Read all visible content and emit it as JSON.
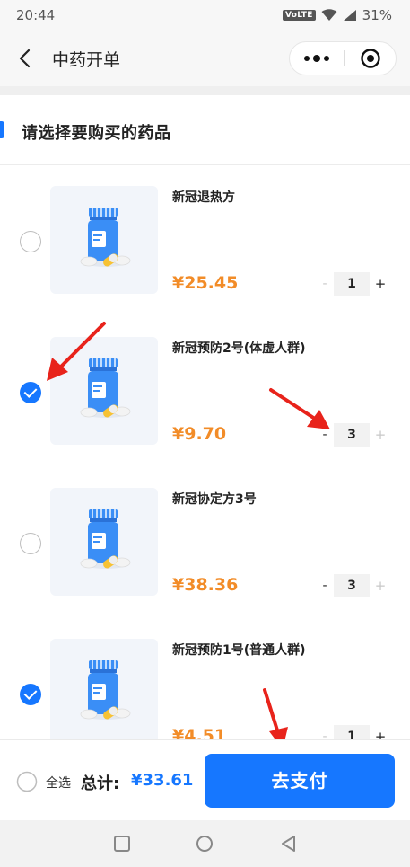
{
  "status_bar": {
    "time": "20:44",
    "network": "VoLTE",
    "battery": "31%"
  },
  "nav": {
    "title": "中药开单",
    "back_icon": "back-arrow-icon",
    "more_icon": "more-dots-icon",
    "close_icon": "record-target-icon"
  },
  "section": {
    "title": "请选择要购买的药品",
    "accent": "#1677ff"
  },
  "items": [
    {
      "name": "新冠退热方",
      "price": "¥25.45",
      "quantity": "1",
      "checked": false,
      "minus_enabled": false,
      "plus_enabled": true
    },
    {
      "name": "新冠预防2号(体虚人群)",
      "price": "¥9.70",
      "quantity": "3",
      "checked": true,
      "minus_enabled": true,
      "plus_enabled": false
    },
    {
      "name": "新冠协定方3号",
      "price": "¥38.36",
      "quantity": "3",
      "checked": false,
      "minus_enabled": true,
      "plus_enabled": false
    },
    {
      "name": "新冠预防1号(普通人群)",
      "price": "¥4.51",
      "quantity": "1",
      "checked": true,
      "minus_enabled": false,
      "plus_enabled": true
    }
  ],
  "stepper": {
    "minus": "-",
    "plus": "+"
  },
  "bottom": {
    "select_all": "全选",
    "total_label": "总计:",
    "total_value": "¥33.61",
    "pay_button": "去支付"
  },
  "colors": {
    "primary": "#1677ff",
    "price": "#f28c28",
    "annotation_arrow": "#e8231b"
  },
  "system_nav": {
    "icons": [
      "square-recents-icon",
      "circle-home-icon",
      "triangle-back-icon"
    ]
  }
}
